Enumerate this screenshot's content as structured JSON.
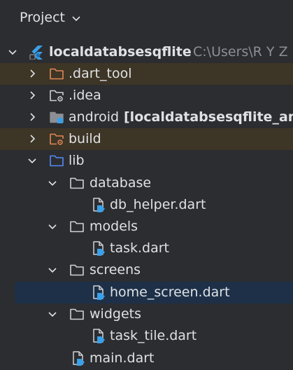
{
  "panel": {
    "title": "Project"
  },
  "tree": {
    "root": {
      "name": "localdatabsesqflite",
      "path": "C:\\Users\\R Y Z"
    },
    "dart_tool": ".dart_tool",
    "idea": ".idea",
    "android": {
      "name": "android",
      "module": "[localdatabsesqflite_and"
    },
    "build": "build",
    "lib": "lib",
    "database": "database",
    "db_helper": "db_helper.dart",
    "models": "models",
    "task": "task.dart",
    "screens": "screens",
    "home_screen": "home_screen.dart",
    "widgets": "widgets",
    "task_tile": "task_tile.dart",
    "main": "main.dart"
  },
  "colors": {
    "background": "#2b2d30",
    "excluded_row": "#3d3526",
    "selected_row": "#1d3048",
    "excluded_folder": "#e08855",
    "source_folder": "#548af7",
    "flutter_blue": "#3aa0e8"
  }
}
